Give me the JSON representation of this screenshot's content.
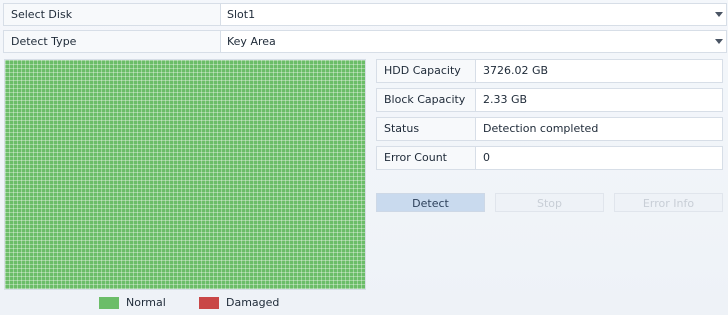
{
  "select_disk": {
    "label": "Select Disk",
    "value": "Slot1",
    "icon": "chevron-down-icon"
  },
  "detect_type": {
    "label": "Detect Type",
    "value": "Key Area",
    "icon": "chevron-down-icon"
  },
  "block_map": {
    "status": "Normal",
    "damaged_blocks": 0
  },
  "legend": {
    "normal_label": "Normal",
    "normal_color": "#6bbd68",
    "damaged_label": "Damaged",
    "damaged_color": "#c94747"
  },
  "info": {
    "hdd_capacity_label": "HDD Capacity",
    "hdd_capacity_value": "3726.02 GB",
    "block_capacity_label": "Block Capacity",
    "block_capacity_value": "2.33 GB",
    "status_label": "Status",
    "status_value": "Detection completed",
    "error_count_label": "Error Count",
    "error_count_value": "0"
  },
  "buttons": {
    "detect": "Detect",
    "stop": "Stop",
    "error_info": "Error Info"
  },
  "colors": {
    "accent_button": "#c9daee",
    "normal_block": "#6bbd68",
    "damaged_block": "#c94747"
  }
}
